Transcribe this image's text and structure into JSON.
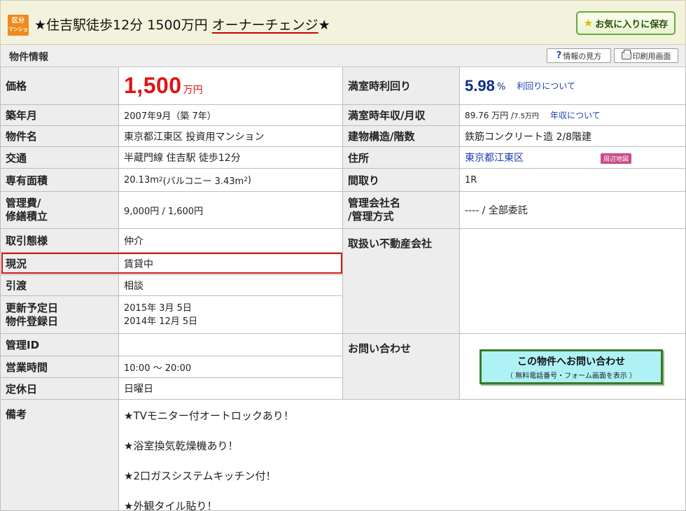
{
  "header": {
    "badge_line1": "区分",
    "badge_line2": "マンション",
    "title_prefix": "★住吉駅徒歩12分 1500万円 ",
    "title_underlined": "オーナーチェンジ",
    "title_suffix": "★",
    "favorite_button": "お気に入りに保存"
  },
  "section": {
    "title": "物件情報",
    "help_button": "情報の見方",
    "print_button": "印刷用画面"
  },
  "rows": {
    "price": {
      "label": "価格",
      "value": "1,500",
      "unit": "万円"
    },
    "yield": {
      "label": "満室時利回り",
      "value": "5.98",
      "unit": "%",
      "link": "利回りについて"
    },
    "built": {
      "label": "築年月",
      "value": "2007年9月（築 7年）"
    },
    "income": {
      "label": "満室時年収/月収",
      "value_prefix": "89.76 万円 / ",
      "value_small": "7.5万円",
      "link": "年収について"
    },
    "name": {
      "label": "物件名",
      "value": "東京都江東区 投資用マンション"
    },
    "structure": {
      "label": "建物構造/階数",
      "value": "鉄筋コンクリート造 2/8階建"
    },
    "transport": {
      "label": "交通",
      "value": "半蔵門線 住吉駅 徒歩12分"
    },
    "address": {
      "label": "住所",
      "value": "東京都江東区",
      "map_button": "周辺地図"
    },
    "area": {
      "label": "専有面積",
      "value_main": "20.13m",
      "value_sup": "2",
      "value_paren": " (バルコニー 3.43m",
      "value_sup2": "2",
      "value_close": ")"
    },
    "layout": {
      "label": "間取り",
      "value": "1R"
    },
    "mgmt_fee": {
      "label_line1": "管理費/",
      "label_line2": "修繕積立",
      "value": "9,000円 / 1,600円"
    },
    "mgmt_company": {
      "label_line1": "管理会社名",
      "label_line2": "/管理方式",
      "value": "---- / 全部委託"
    },
    "transaction": {
      "label": "取引態様",
      "value": "仲介"
    },
    "agency": {
      "label": "取扱い不動産会社",
      "value": ""
    },
    "status": {
      "label": "現況",
      "value": "賃貸中"
    },
    "handover": {
      "label": "引渡",
      "value": "相談"
    },
    "dates": {
      "label_line1": "更新予定日",
      "label_line2": "物件登録日",
      "value_line1": "2015年 3月 5日",
      "value_line2": "2014年 12月 5日"
    },
    "mgmt_id": {
      "label": "管理ID",
      "value": ""
    },
    "inquiry": {
      "label": "お問い合わせ",
      "button_line1": "この物件へお問い合わせ",
      "button_line2": "（ 無料電話番号・フォーム画面を表示 ）"
    },
    "hours": {
      "label": "営業時間",
      "value": "10:00 ～ 20:00"
    },
    "holiday": {
      "label": "定休日",
      "value": "日曜日"
    },
    "remarks": {
      "label": "備考",
      "items": [
        "★TVモニター付オートロックあり！",
        "★浴室換気乾燥機あり！",
        "★2口ガスシステムキッチン付！",
        "★外観タイル貼り！"
      ]
    }
  },
  "colors": {
    "price": "#e01414",
    "yield": "#0c2c8a",
    "highlight_border": "#d21a1a",
    "inquiry_bg": "#aef2f5"
  }
}
